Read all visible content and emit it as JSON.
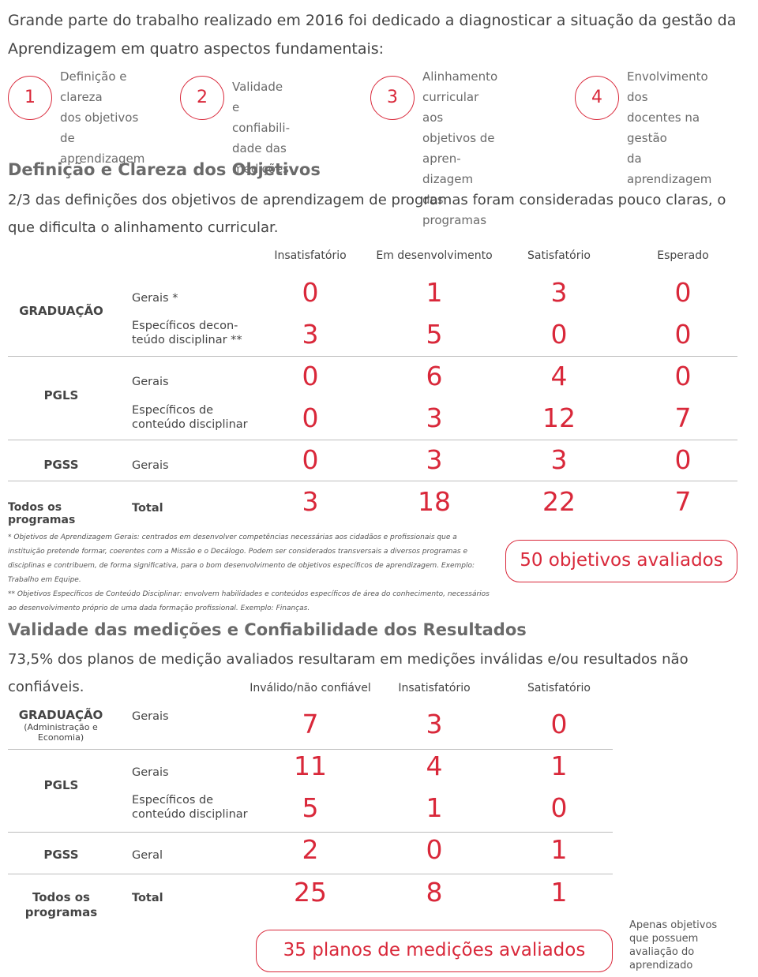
{
  "intro": "Grande parte do trabalho realizado em 2016 foi dedicado a diagnosticar a situação da gestão da Aprendizagem em quatro aspectos fundamentais:",
  "aspects": [
    {
      "number": "1",
      "label": "Definição e clareza\ndos objetivos de\naprendizagem"
    },
    {
      "number": "2",
      "label": "Validade e confiabili-\ndade das medições"
    },
    {
      "number": "3",
      "label": "Alinhamento curricular\naos objetivos de apren-\ndizagem dos programas"
    },
    {
      "number": "4",
      "label": "Envolvimento dos\ndocentes na gestão\nda aprendizagem"
    }
  ],
  "section1": {
    "title": "Definição e Clareza dos Objetivos",
    "subtitle": "2/3 das definições dos objetivos de aprendizagem de programas foram consideradas pouco claras, o que dificulta o alinhamento curricular.",
    "columns": [
      "Insatisfatório",
      "Em desenvolvimento",
      "Satisfatório",
      "Esperado"
    ],
    "groups": [
      {
        "name": "GRADUAÇÃO",
        "rows": [
          {
            "label": "Gerais *",
            "values": [
              "0",
              "1",
              "3",
              "0"
            ]
          },
          {
            "label": "Específicos decon-\nteúdo disciplinar **",
            "values": [
              "3",
              "5",
              "0",
              "0"
            ]
          }
        ]
      },
      {
        "name": "PGLS",
        "rows": [
          {
            "label": "Gerais",
            "values": [
              "0",
              "6",
              "4",
              "0"
            ]
          },
          {
            "label": "Específicos de\nconteúdo disciplinar",
            "values": [
              "0",
              "3",
              "12",
              "7"
            ]
          }
        ]
      },
      {
        "name": "PGSS",
        "rows": [
          {
            "label": "Gerais",
            "values": [
              "0",
              "3",
              "3",
              "0"
            ]
          }
        ]
      },
      {
        "name": "Todos os programas",
        "rows": [
          {
            "label": "Total",
            "values": [
              "3",
              "18",
              "22",
              "7"
            ]
          }
        ]
      }
    ],
    "footnote1": "* Objetivos de Aprendizagem Gerais: centrados em desenvolver competências necessárias aos cidadãos e profissionais que a instituição pretende formar, coerentes com a Missão e o Decálogo. Podem ser considerados transversais a diversos programas e disciplinas e contribuem, de forma significativa, para o bom desenvolvimento de objetivos específicos de aprendizagem. Exemplo: Trabalho em Equipe.",
    "footnote2": "** Objetivos Específicos de Conteúdo Disciplinar: envolvem habilidades e conteúdos específicos de área do conhecimento, necessários ao desenvolvimento próprio de uma dada formação profissional. Exemplo: Finanças.",
    "badge": "50 objetivos avaliados"
  },
  "section2": {
    "title": "Validade das medições e Confiabilidade dos Resultados",
    "subtitle": "73,5% dos planos de medição avaliados resultaram em medições inválidas e/ou resultados não confiáveis.",
    "columns": [
      "Inválido/não confiável",
      "Insatisfatório",
      "Satisfatório"
    ],
    "groups": [
      {
        "name": "GRADUAÇÃO",
        "sub": "(Administração e Economia)",
        "rows": [
          {
            "label": "Gerais",
            "values": [
              "7",
              "3",
              "0"
            ]
          }
        ]
      },
      {
        "name": "PGLS",
        "rows": [
          {
            "label": "Gerais",
            "values": [
              "11",
              "4",
              "1"
            ]
          },
          {
            "label": "Específicos de\nconteúdo disciplinar",
            "values": [
              "5",
              "1",
              "0"
            ]
          }
        ]
      },
      {
        "name": "PGSS",
        "rows": [
          {
            "label": "Geral",
            "values": [
              "2",
              "0",
              "1"
            ]
          }
        ]
      },
      {
        "name": "Todos os\nprogramas",
        "rows": [
          {
            "label": "Total",
            "values": [
              "25",
              "8",
              "1"
            ]
          }
        ]
      }
    ],
    "badge": "35 planos de medições avaliados",
    "note": "Apenas objetivos\nque possuem\navaliação do\naprendizado"
  }
}
